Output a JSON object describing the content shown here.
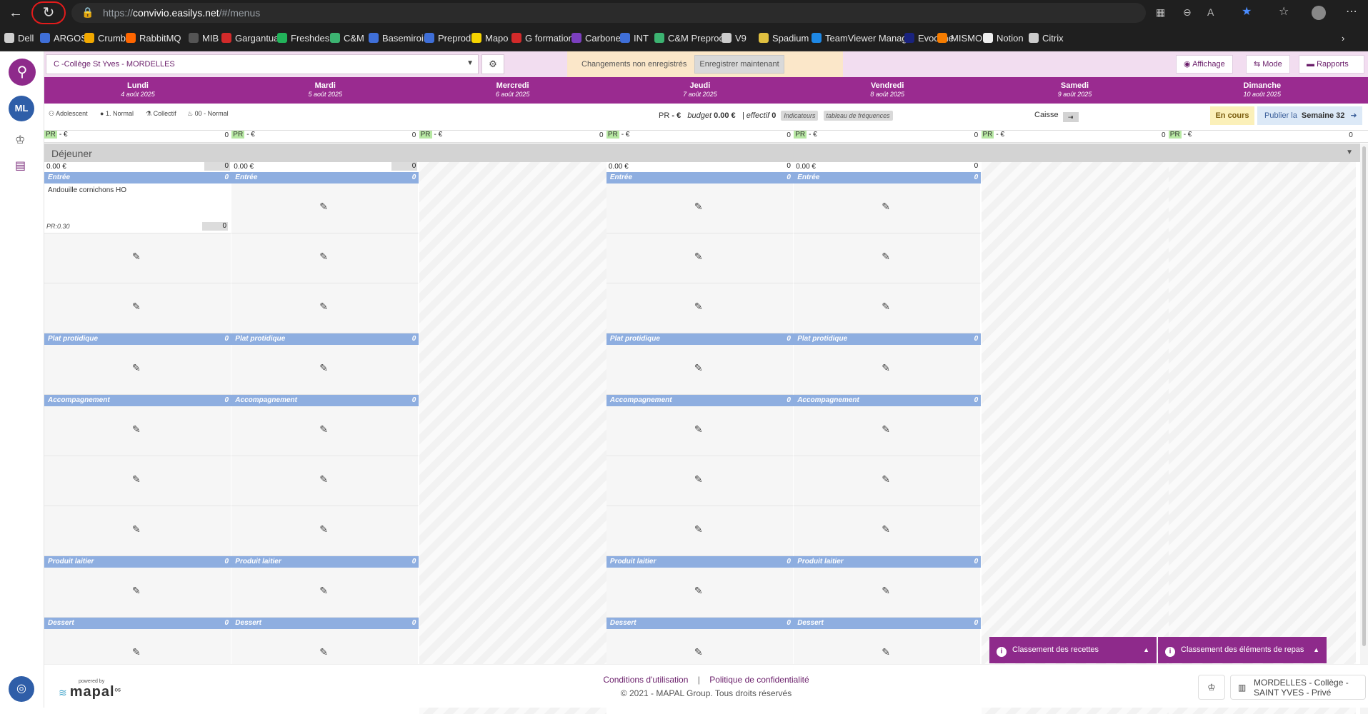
{
  "browser": {
    "url_prefix": "https://",
    "url_host": "convivio.easilys.net",
    "url_path": "/#/menus",
    "bookmarks": [
      {
        "label": "Dell",
        "color": "#cfcfcf"
      },
      {
        "label": "ARGOS",
        "color": "#3f6fd8"
      },
      {
        "label": "Crumble",
        "color": "#f2a900"
      },
      {
        "label": "RabbitMQ",
        "color": "#ff6600"
      },
      {
        "label": "MIB",
        "color": "#555555"
      },
      {
        "label": "Gargantua",
        "color": "#d22a2a"
      },
      {
        "label": "Freshdesk",
        "color": "#22b35a"
      },
      {
        "label": "C&M",
        "color": "#3cb371"
      },
      {
        "label": "Basemiroir",
        "color": "#3f6fd8"
      },
      {
        "label": "Preprod",
        "color": "#3f6fd8"
      },
      {
        "label": "Mapo",
        "color": "#f5d300"
      },
      {
        "label": "G formation",
        "color": "#d22a2a"
      },
      {
        "label": "Carbone",
        "color": "#7b3fbf"
      },
      {
        "label": "INT",
        "color": "#3f6fd8"
      },
      {
        "label": "C&M Preprod",
        "color": "#3cb371"
      },
      {
        "label": "V9",
        "color": "#cccccc"
      },
      {
        "label": "Spadium",
        "color": "#e0c040"
      },
      {
        "label": "TeamViewer Manag...",
        "color": "#1e88e5"
      },
      {
        "label": "Evocime",
        "color": "#1a237e"
      },
      {
        "label": "MISMO",
        "color": "#f57c00"
      },
      {
        "label": "Notion",
        "color": "#eeeeee"
      },
      {
        "label": "Citrix",
        "color": "#cccccc"
      }
    ]
  },
  "rail": {
    "avatar": "ML"
  },
  "topbar": {
    "site": "C -Collège St Yves - MORDELLES",
    "unsaved_msg": "Changements non enregistrés",
    "save_now": "Enregistrer maintenant",
    "affichage": "Affichage",
    "mode": "Mode",
    "rapports": "Rapports"
  },
  "days": [
    {
      "name": "Lundi",
      "date": "4 août 2025"
    },
    {
      "name": "Mardi",
      "date": "5 août 2025"
    },
    {
      "name": "Mercredi",
      "date": "6 août 2025"
    },
    {
      "name": "Jeudi",
      "date": "7 août 2025"
    },
    {
      "name": "Vendredi",
      "date": "8 août 2025"
    },
    {
      "name": "Samedi",
      "date": "9 août 2025"
    },
    {
      "name": "Dimanche",
      "date": "10 août 2025"
    }
  ],
  "info": {
    "tags": [
      "Adolescent",
      "1. Normal",
      "Collectif",
      "00 - Normal"
    ],
    "pr": "PR",
    "pr_value": "- €",
    "budget_label": "budget",
    "budget_value": "0.00 €",
    "effectif_label": "| effectif",
    "effectif_value": "0",
    "indicateurs": "Indicateurs",
    "frequences": "tableau de fréquences",
    "caisse": "Caisse",
    "en_cours": "En cours",
    "publier": "Publier la",
    "semaine": "Semaine 32"
  },
  "pr_row": {
    "label": "PR",
    "value": "- €",
    "count": "0"
  },
  "meal": {
    "title": "Déjeuner"
  },
  "active_day": {
    "total": "0.00 €",
    "count": "0"
  },
  "sections": {
    "entree": "Entrée",
    "plat": "Plat protidique",
    "accomp": "Accompagnement",
    "laitier": "Produit laitier",
    "dessert": "Dessert",
    "count": "0"
  },
  "filled_dish": {
    "name": "Andouille cornichons HO",
    "pr": "PR:0.30",
    "count": "0"
  },
  "panels": {
    "recettes": "Classement des recettes",
    "elements": "Classement des éléments de repas"
  },
  "footer": {
    "powered": "powered by",
    "brand": "mapal",
    "brand_suffix": "os",
    "conditions": "Conditions d'utilisation",
    "separator": "|",
    "politique": "Politique de confidentialité",
    "copyright": "© 2021 - MAPAL Group. Tous droits réservés",
    "site_line1": "MORDELLES - Collège -",
    "site_line2": "SAINT YVES - Privé"
  }
}
